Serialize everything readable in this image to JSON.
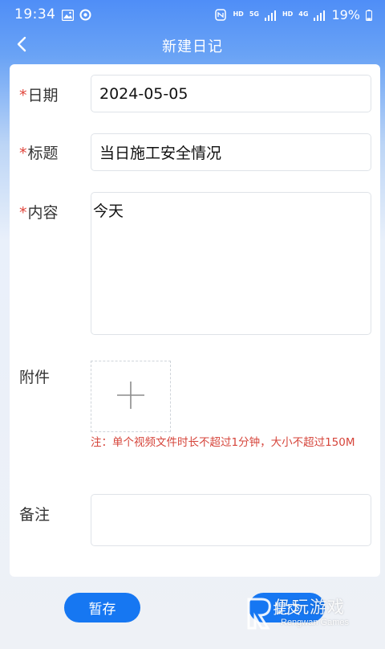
{
  "status_bar": {
    "time": "19:34",
    "hd1": "HD",
    "sig1": "5G",
    "hd2": "HD",
    "sig2": "4G",
    "battery": "19%",
    "icons": [
      "gallery-icon",
      "sync-icon",
      "nfc-icon",
      "signal-icon",
      "battery-icon"
    ]
  },
  "nav": {
    "title": "新建日记",
    "back_icon": "chevron-left-icon"
  },
  "form": {
    "date": {
      "required_mark": "*",
      "label": "日期",
      "value": "2024-05-05"
    },
    "title": {
      "required_mark": "*",
      "label": "标题",
      "value": "当日施工安全情况"
    },
    "content": {
      "required_mark": "*",
      "label": "内容",
      "value": "今天"
    },
    "attachment": {
      "label": "附件",
      "upload_icon": "plus-icon",
      "note": "注：单个视频文件时长不超过1分钟，大小不超过150M"
    },
    "remarks": {
      "label": "备注",
      "value": ""
    }
  },
  "actions": {
    "save_draft": "暂存",
    "submit": "提交"
  },
  "watermark": {
    "text": "仍玩游戏",
    "sub": "Rengwan Games"
  },
  "colors": {
    "primary": "#1677f2",
    "header_gradient_top": "#4f8ef7",
    "required": "#e0443a",
    "note": "#d6453b"
  }
}
